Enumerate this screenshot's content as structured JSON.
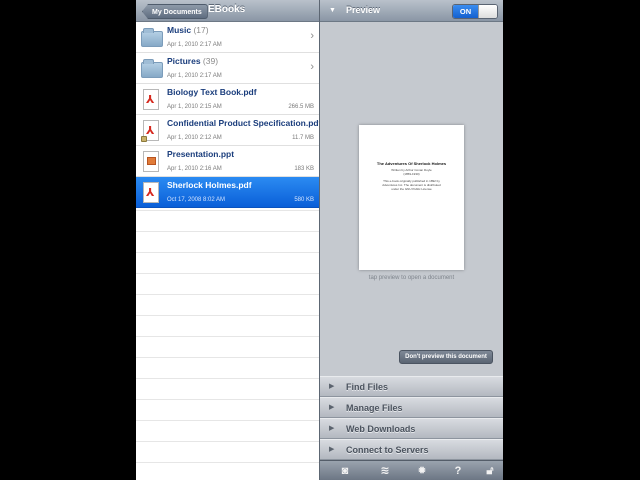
{
  "left_pane": {
    "back_button": "My Documents",
    "title": "EBooks",
    "files": [
      {
        "name": "Music",
        "count": "(17)",
        "date": "Apr 1, 2010 2:17 AM",
        "size": "",
        "type": "folder",
        "selected": false
      },
      {
        "name": "Pictures",
        "count": "(39)",
        "date": "Apr 1, 2010 2:17 AM",
        "size": "",
        "type": "folder",
        "selected": false
      },
      {
        "name": "Biology Text Book.pdf",
        "count": "",
        "date": "Apr 1, 2010 2:15 AM",
        "size": "266.5 MB",
        "type": "pdf",
        "selected": false
      },
      {
        "name": "Confidential Product Specification.pdf",
        "count": "",
        "date": "Apr 1, 2010 2:12 AM",
        "size": "11.7 MB",
        "type": "pdf-locked",
        "selected": false
      },
      {
        "name": "Presentation.ppt",
        "count": "",
        "date": "Apr 1, 2010 2:16 AM",
        "size": "183 KB",
        "type": "ppt",
        "selected": false
      },
      {
        "name": "Sherlock Holmes.pdf",
        "count": "",
        "date": "Oct 17, 2008 8:02 AM",
        "size": "580 KB",
        "type": "pdf",
        "selected": true
      }
    ]
  },
  "right_pane": {
    "title": "Preview",
    "toggle_label": "ON",
    "toggle_on": true,
    "document_title": "The Adventures Of Sherlock Holmes",
    "document_lines": [
      "Written by Arthur Conan Doyle",
      "(1859-1930)",
      "This e-book originally published in 1892 by",
      "Adventures Inc. The document is distributed",
      "under the GNU Public License"
    ],
    "tap_hint": "tap preview to open a document",
    "dont_preview_button": "Don't preview this document",
    "menu": [
      "Find Files",
      "Manage Files",
      "Web Downloads",
      "Connect to Servers"
    ],
    "toolbar": [
      "camera-icon",
      "wifi-icon",
      "gear-icon",
      "help-icon",
      "lock-icon"
    ]
  },
  "colors": {
    "selection": "#0a5fd8",
    "header_bar": "#8a96a5",
    "pdf_red": "#d6291e"
  }
}
